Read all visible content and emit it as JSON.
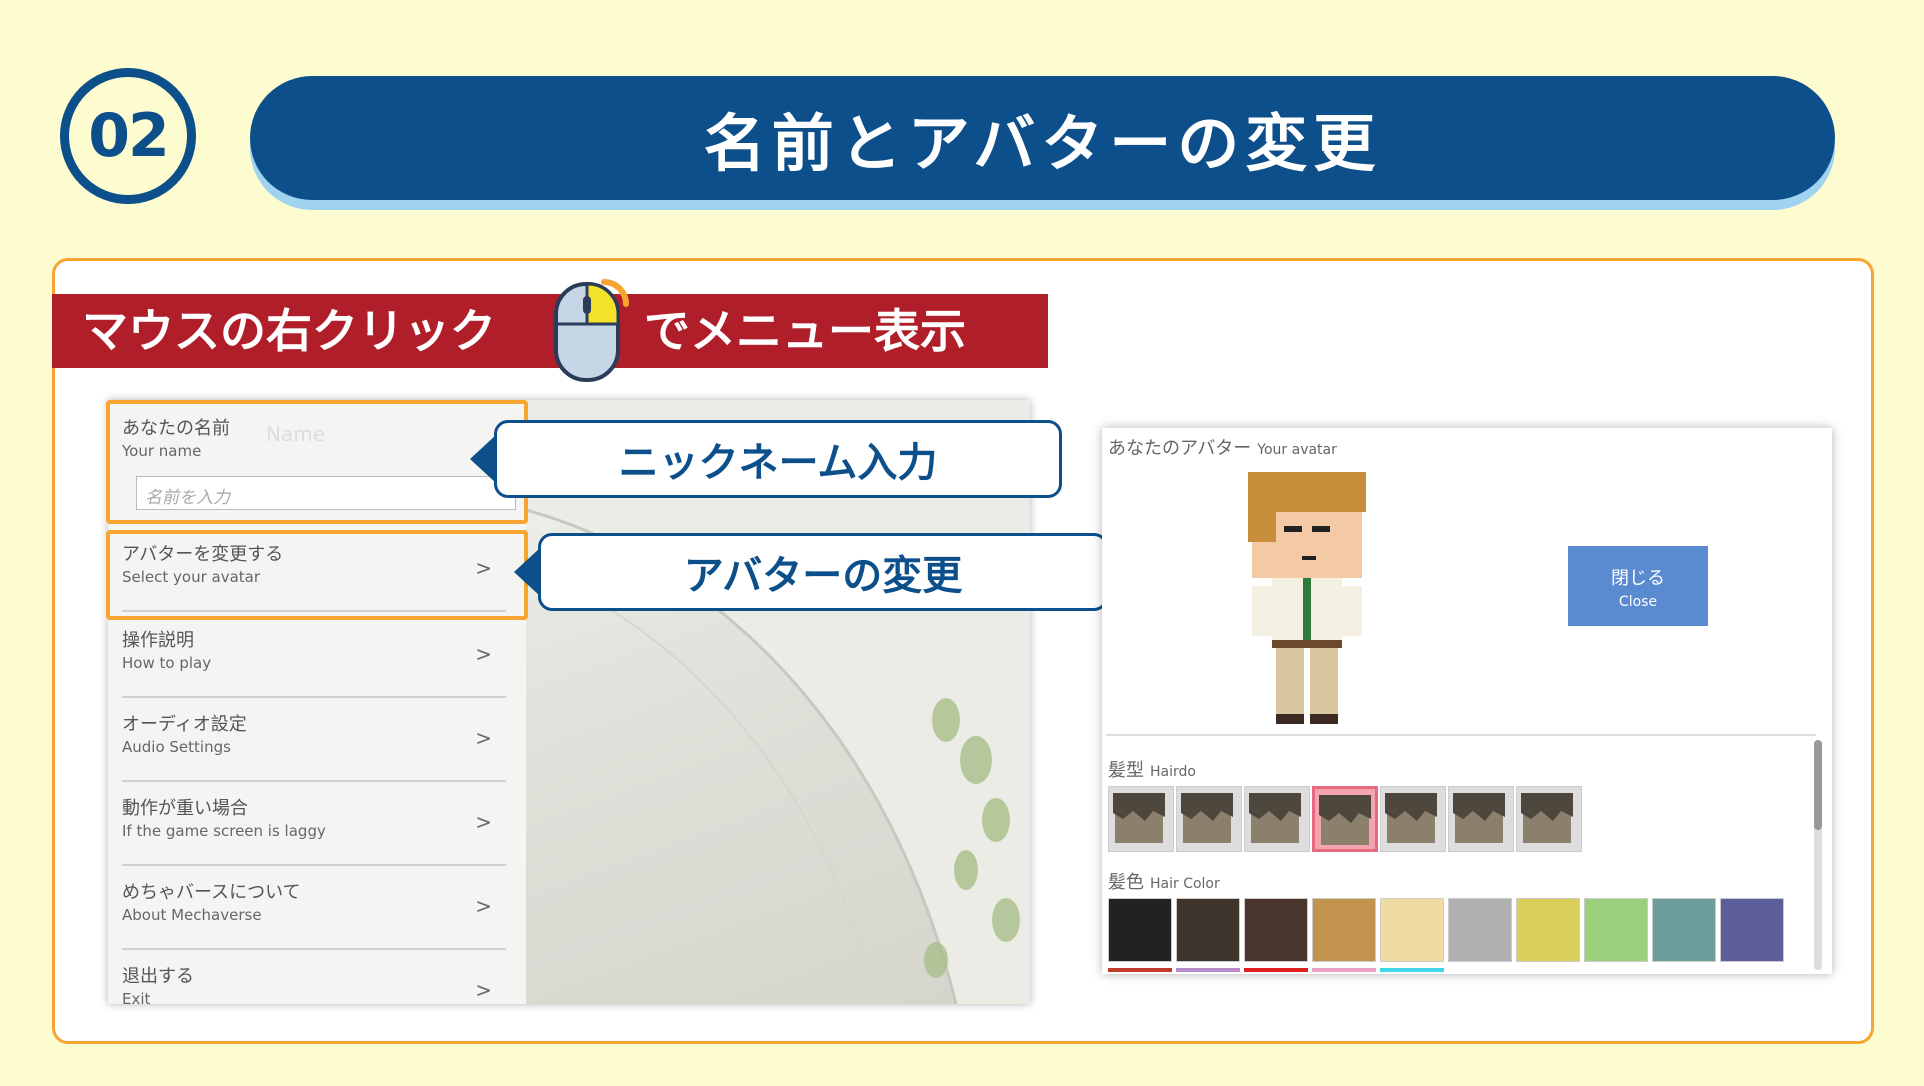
{
  "step": {
    "number": "02"
  },
  "title": "名前とアバターの変更",
  "banner": {
    "left": "マウスの右クリック",
    "right": "でメニュー表示"
  },
  "menu": {
    "name_item": {
      "jp": "あなたの名前",
      "en": "Your name",
      "ghost": "Name",
      "placeholder": "名前を入力"
    },
    "items": [
      {
        "jp": "アバターを変更する",
        "en": "Select your avatar",
        "chevron": ">"
      },
      {
        "jp": "操作説明",
        "en": "How to play",
        "chevron": ">"
      },
      {
        "jp": "オーディオ設定",
        "en": "Audio Settings",
        "chevron": ">"
      },
      {
        "jp": "動作が重い場合",
        "en": "If the game screen is laggy",
        "chevron": ">"
      },
      {
        "jp": "めちゃバースについて",
        "en": "About Mechaverse",
        "chevron": ">"
      },
      {
        "jp": "退出する",
        "en": "Exit",
        "chevron": ">"
      }
    ]
  },
  "callouts": {
    "nickname": "ニックネーム入力",
    "avatar": "アバターの変更"
  },
  "avatar_panel": {
    "title_jp": "あなたのアバター",
    "title_en": "Your avatar",
    "close_jp": "閉じる",
    "close_en": "Close",
    "hairdo_jp": "髪型",
    "hairdo_en": "Hairdo",
    "haircolor_jp": "髪色",
    "haircolor_en": "Hair Color",
    "hair_colors": [
      "#222222",
      "#3e342b",
      "#4a362c",
      "#c2934e",
      "#f0dca0",
      "#b0b0b0",
      "#d8cf5a",
      "#9ccf7c",
      "#6e9e9c",
      "#5c5e9c"
    ],
    "underline_colors": [
      "#c0392b",
      "#b98cd0",
      "#e02020",
      "#f0a0c0",
      "#40d8e8"
    ]
  },
  "colors": {
    "navy": "#0c4f8a",
    "orange": "#f7a530",
    "red_banner": "#b01e2a",
    "background": "#fcfcd0"
  }
}
